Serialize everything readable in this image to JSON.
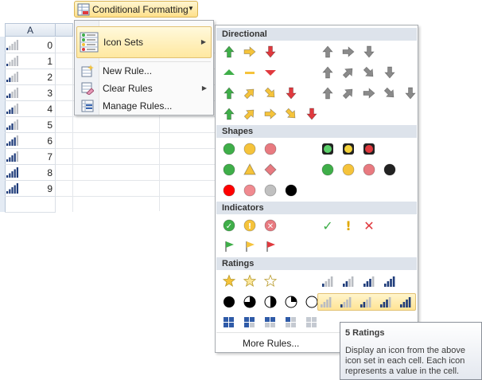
{
  "ribbon": {
    "button_label": "Conditional Formatting"
  },
  "sheet": {
    "column_header": "A",
    "rows": [
      {
        "value": "0",
        "level": 1
      },
      {
        "value": "1",
        "level": 1
      },
      {
        "value": "2",
        "level": 2
      },
      {
        "value": "3",
        "level": 2
      },
      {
        "value": "4",
        "level": 3
      },
      {
        "value": "5",
        "level": 3
      },
      {
        "value": "6",
        "level": 4
      },
      {
        "value": "7",
        "level": 4
      },
      {
        "value": "8",
        "level": 5
      },
      {
        "value": "9",
        "level": 5
      }
    ]
  },
  "menu": {
    "items": [
      {
        "label": "Icon Sets",
        "icon": "icon-sets-icon",
        "has_submenu": true,
        "active": true
      },
      {
        "label": "New Rule...",
        "icon": "new-rule-icon",
        "has_submenu": false
      },
      {
        "label": "Clear Rules",
        "icon": "clear-rules-icon",
        "has_submenu": true
      },
      {
        "label": "Manage Rules...",
        "icon": "manage-rules-icon",
        "has_submenu": false
      }
    ]
  },
  "gallery": {
    "sections": {
      "directional": "Directional",
      "shapes": "Shapes",
      "indicators": "Indicators",
      "ratings": "Ratings"
    },
    "selected_item": "5 Ratings",
    "more_rules": "More Rules..."
  },
  "tooltip": {
    "title": "5 Ratings",
    "body": "Display an icon from the above icon set in each cell. Each icon represents a value in the cell."
  },
  "colors": {
    "green": "#3fae49",
    "yellow": "#f5c33b",
    "red": "#e0393e",
    "gray": "#8a8a8a",
    "dark_blue": "#1f3c7a",
    "highlight": "#ffe394"
  }
}
